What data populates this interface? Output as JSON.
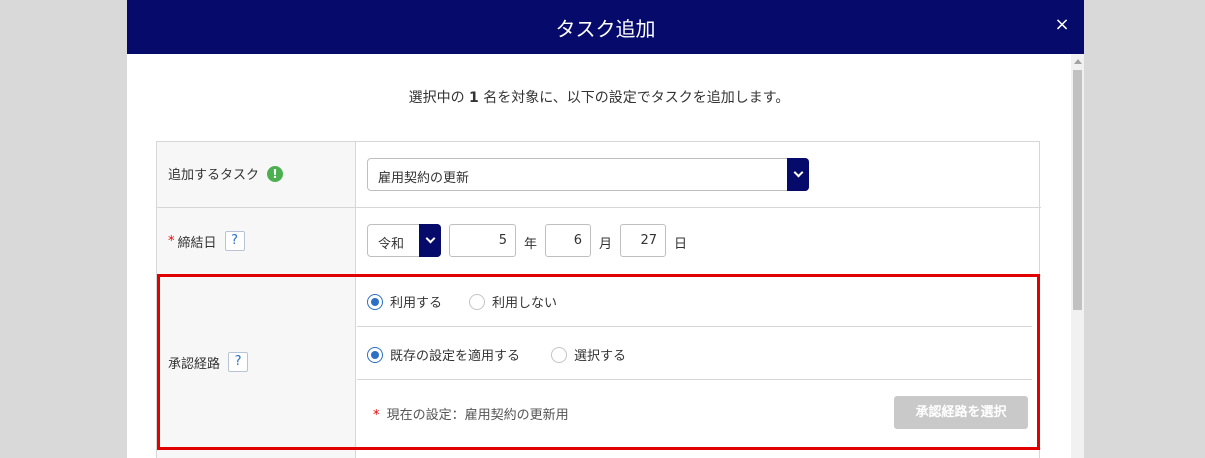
{
  "dialog": {
    "title": "タスク追加",
    "close_label": "×"
  },
  "intro": {
    "before": "選択中の ",
    "count": "1",
    "after": " 名を対象に、以下の設定でタスクを追加します。"
  },
  "task_row": {
    "label": "追加するタスク",
    "info_icon": "!",
    "selected": "雇用契約の更新"
  },
  "date_row": {
    "required_mark": "*",
    "label": "締結日",
    "help_label": "?",
    "era": "令和",
    "year": "5",
    "year_unit": "年",
    "month": "6",
    "month_unit": "月",
    "day": "27",
    "day_unit": "日"
  },
  "approval_row": {
    "label": "承認経路",
    "help_label": "?",
    "use_options": [
      {
        "label": "利用する",
        "selected": true
      },
      {
        "label": "利用しない",
        "selected": false
      }
    ],
    "setting_options": [
      {
        "label": "既存の設定を適用する",
        "selected": true
      },
      {
        "label": "選択する",
        "selected": false
      }
    ],
    "required_mark": "*",
    "current_setting": "現在の設定：雇用契約の更新用",
    "select_button": "承認経路を選択"
  },
  "colors": {
    "header": "#050a6b",
    "highlight": "#e00000",
    "radio_on": "#2c6fc7",
    "info_icon": "#4caf50"
  }
}
